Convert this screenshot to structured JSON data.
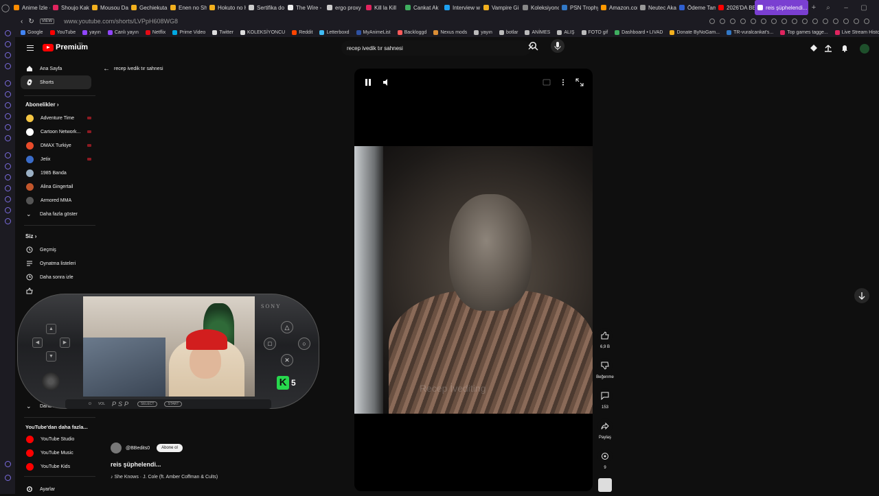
{
  "browser": {
    "tabs": [
      {
        "title": "Anime İzle -",
        "color": "#ff8c00"
      },
      {
        "title": "Shoujo Kak",
        "color": "#e0245e"
      },
      {
        "title": "Mousou Da",
        "color": "#f2b01e"
      },
      {
        "title": "Gechiekuta",
        "color": "#f2b01e"
      },
      {
        "title": "Enen no Sh",
        "color": "#f2b01e"
      },
      {
        "title": "Hokuto no H",
        "color": "#f2b01e"
      },
      {
        "title": "Sertifika do",
        "color": "#cccccc"
      },
      {
        "title": "The Wire -",
        "color": "#eeeeee"
      },
      {
        "title": "ergo proxy",
        "color": "#cccccc"
      },
      {
        "title": "Kill la Kill",
        "color": "#e0245e"
      },
      {
        "title": "Cankat Ak",
        "color": "#3fae5f"
      },
      {
        "title": "Interview w",
        "color": "#1da1f2"
      },
      {
        "title": "Vampire Gi",
        "color": "#f2b01e"
      },
      {
        "title": "Koleksiyonc",
        "color": "#888888"
      },
      {
        "title": "PSN Trophy",
        "color": "#3178c6"
      },
      {
        "title": "Amazon.com",
        "color": "#ff9900"
      },
      {
        "title": "Neutec Aka",
        "color": "#999999"
      },
      {
        "title": "Ödeme Tam",
        "color": "#2f5fd0"
      },
      {
        "title": "2026'DA BE",
        "color": "#ff0000"
      }
    ],
    "active_tab": "reis şüphelendi...",
    "new_tab": "+",
    "url": "www.youtube.com/shorts/LVPpH608WG8",
    "bookmarks": [
      {
        "label": "Google",
        "color": "#4285f4"
      },
      {
        "label": "YouTube",
        "color": "#ff0000"
      },
      {
        "label": "yayın",
        "color": "#9146ff"
      },
      {
        "label": "Canlı yayın",
        "color": "#9146ff"
      },
      {
        "label": "Netflix",
        "color": "#e50914"
      },
      {
        "label": "Prime Video",
        "color": "#00a8e1"
      },
      {
        "label": "Twitter",
        "color": "#dddddd"
      },
      {
        "label": "KOLEKSİYONCU",
        "color": "#dddddd"
      },
      {
        "label": "Reddit",
        "color": "#ff4500"
      },
      {
        "label": "Letterboxd",
        "color": "#40bcf4"
      },
      {
        "label": "MyAnimeList",
        "color": "#2e51a2"
      },
      {
        "label": "Backloggd",
        "color": "#ff5a5a"
      },
      {
        "label": "Nexus mods",
        "color": "#da8e35"
      },
      {
        "label": "yayın",
        "color": "#bbbbbb"
      },
      {
        "label": "botlar",
        "color": "#bbbbbb"
      },
      {
        "label": "ANİMES",
        "color": "#bbbbbb"
      },
      {
        "label": "ALIŞ",
        "color": "#bbbbbb"
      },
      {
        "label": "FOTO gif",
        "color": "#bbbbbb"
      },
      {
        "label": "Dashboard • LIVAD",
        "color": "#3fae5f"
      },
      {
        "label": "Donate ByNoGam...",
        "color": "#f2b01e"
      },
      {
        "label": "TR-vuralcankat's...",
        "color": "#3178c6"
      },
      {
        "label": "Top games tagge...",
        "color": "#e0245e"
      },
      {
        "label": "Live Stream Histor...",
        "color": "#e0245e"
      }
    ]
  },
  "youtube": {
    "logo_text": "Premium",
    "logo_country": "TR",
    "search_value": "recep ivedik tır sahnesi",
    "sidebar": {
      "main": [
        {
          "label": "Ana Sayfa",
          "icon": "home-icon"
        },
        {
          "label": "Shorts",
          "icon": "shorts-icon"
        }
      ],
      "subs_heading": "Abonelikler",
      "subscriptions": [
        {
          "label": "Adventure Time",
          "avatar_color": "#f4c542"
        },
        {
          "label": "Cartoon Network...",
          "avatar_color": "#ffffff"
        },
        {
          "label": "DMAX Turkiye",
          "avatar_color": "#e84b2a"
        },
        {
          "label": "Jetix",
          "avatar_color": "#3a6cc9"
        },
        {
          "label": "1985 Banda",
          "avatar_color": "#9bb0c4"
        },
        {
          "label": "Alina Gingertail",
          "avatar_color": "#c2562b"
        },
        {
          "label": "Armored MMA",
          "avatar_color": "#555555"
        }
      ],
      "show_more": "Daha fazla göster",
      "you_heading": "Siz",
      "you_items": [
        {
          "label": "Geçmiş",
          "icon": "history-icon"
        },
        {
          "label": "Oynatma listeleri",
          "icon": "playlist-icon"
        },
        {
          "label": "Daha sonra izle",
          "icon": "clock-icon"
        }
      ],
      "collapsed_item": "Daha fa...",
      "more_heading": "YouTube'dan daha fazla...",
      "more_items": [
        {
          "label": "YouTube Studio"
        },
        {
          "label": "YouTube Music"
        },
        {
          "label": "YouTube Kids"
        }
      ],
      "settings": "Ayarlar"
    },
    "back_label": "recep ivedik tır sahnesi",
    "video": {
      "watermark": "Recep İvediting"
    },
    "actions": {
      "likes": "6,9 B",
      "dislike_label": "Beğenme",
      "comments": "153",
      "share_label": "Paylaş",
      "remix": "9"
    },
    "channel": {
      "handle": "@BBedits0",
      "subscribe_label": "Abone ol"
    },
    "title": "reis şüphelendi...",
    "music": "♪ She Knows · J. Cole (ft. Amber Coffman & Cults)"
  },
  "overlay": {
    "brand": "SONY",
    "bar_labels": [
      "VOL",
      "SELECT",
      "START"
    ],
    "bar_logo": "PSP",
    "kick_logo": "K",
    "kick_count": "5"
  }
}
